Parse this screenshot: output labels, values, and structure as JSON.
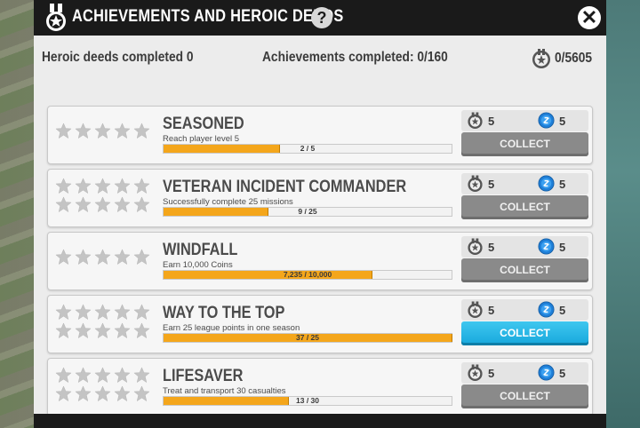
{
  "header": {
    "title": "ACHIEVEMENTS AND HEROIC DEEDS",
    "help_glyph": "?",
    "close_glyph": "✕"
  },
  "stats": {
    "heroic_deeds": "Heroic deeds completed 0",
    "achievements": "Achievements completed: 0/160",
    "points": "0/5605"
  },
  "colors": {
    "progress_fill": "#f4a61b",
    "collect_inactive": "#8a8a8a",
    "collect_active": "#16a7dc",
    "header_bg": "#1a1a1a"
  },
  "achievements": [
    {
      "name": "SEASONED",
      "description": "Reach player level 5",
      "progress_text": "2 / 5",
      "progress": 0.4,
      "star_rows": 1,
      "reward_medal": "5",
      "reward_coin": "5",
      "button": "COLLECT",
      "collectable": false
    },
    {
      "name": "VETERAN INCIDENT COMMANDER",
      "description": "Successfully complete 25 missions",
      "progress_text": "9 / 25",
      "progress": 0.36,
      "star_rows": 2,
      "reward_medal": "5",
      "reward_coin": "5",
      "button": "COLLECT",
      "collectable": false
    },
    {
      "name": "WINDFALL",
      "description": "Earn 10,000 Coins",
      "progress_text": "7,235 / 10,000",
      "progress": 0.7235,
      "star_rows": 1,
      "reward_medal": "5",
      "reward_coin": "5",
      "button": "COLLECT",
      "collectable": false
    },
    {
      "name": "WAY TO THE TOP",
      "description": "Earn 25 league points in one season",
      "progress_text": "37 / 25",
      "progress": 1.0,
      "star_rows": 2,
      "reward_medal": "5",
      "reward_coin": "5",
      "button": "COLLECT",
      "collectable": true
    },
    {
      "name": "LIFESAVER",
      "description": "Treat and transport 30 casualties",
      "progress_text": "13 / 30",
      "progress": 0.4333,
      "star_rows": 2,
      "reward_medal": "5",
      "reward_coin": "5",
      "button": "COLLECT",
      "collectable": false
    }
  ],
  "icons": {
    "header_medal": "medal-icon",
    "points": "medal-points-icon",
    "reward_medal": "medal-reward-icon",
    "reward_coin": "coin-icon",
    "star": "star-icon"
  }
}
